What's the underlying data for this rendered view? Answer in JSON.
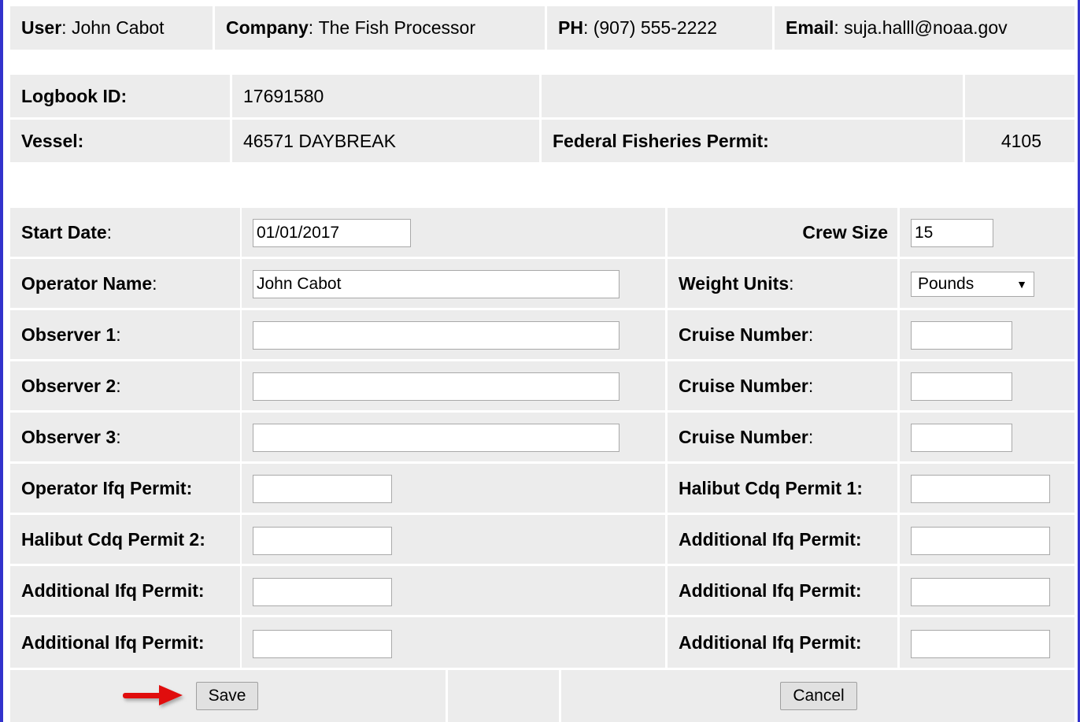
{
  "header": {
    "user_label": "User",
    "user_value": "John Cabot",
    "company_label": "Company",
    "company_value": "The Fish Processor",
    "phone_label": "PH",
    "phone_value": "(907) 555-2222",
    "email_label": "Email",
    "email_value": "suja.halll@noaa.gov"
  },
  "logbook": {
    "id_label": "Logbook ID:",
    "id_value": "17691580",
    "vessel_label": "Vessel:",
    "vessel_value": "46571 DAYBREAK",
    "ffp_label": "Federal Fisheries Permit:",
    "ffp_value": "4105"
  },
  "form": {
    "start_date_label": "Start Date",
    "start_date_value": "01/01/2017",
    "crew_size_label": "Crew Size",
    "crew_size_value": "15",
    "operator_name_label": "Operator Name",
    "operator_name_value": "John Cabot",
    "weight_units_label": "Weight Units",
    "weight_units_value": "Pounds",
    "observer1_label": "Observer 1",
    "observer2_label": "Observer 2",
    "observer3_label": "Observer 3",
    "cruise_number_label": "Cruise Number",
    "operator_ifq_label": "Operator Ifq Permit:",
    "halibut_cdq1_label": "Halibut Cdq Permit 1:",
    "halibut_cdq2_label": "Halibut Cdq Permit 2:",
    "additional_ifq_label": "Additional Ifq Permit:",
    "colon": ":"
  },
  "actions": {
    "save_label": "Save",
    "cancel_label": "Cancel"
  },
  "colors": {
    "row_bg": "#ececec",
    "frame": "#3333cc",
    "arrow": "#e01010"
  },
  "icons": {
    "arrow": "arrow-right-icon",
    "dropdown": "chevron-down-icon"
  }
}
